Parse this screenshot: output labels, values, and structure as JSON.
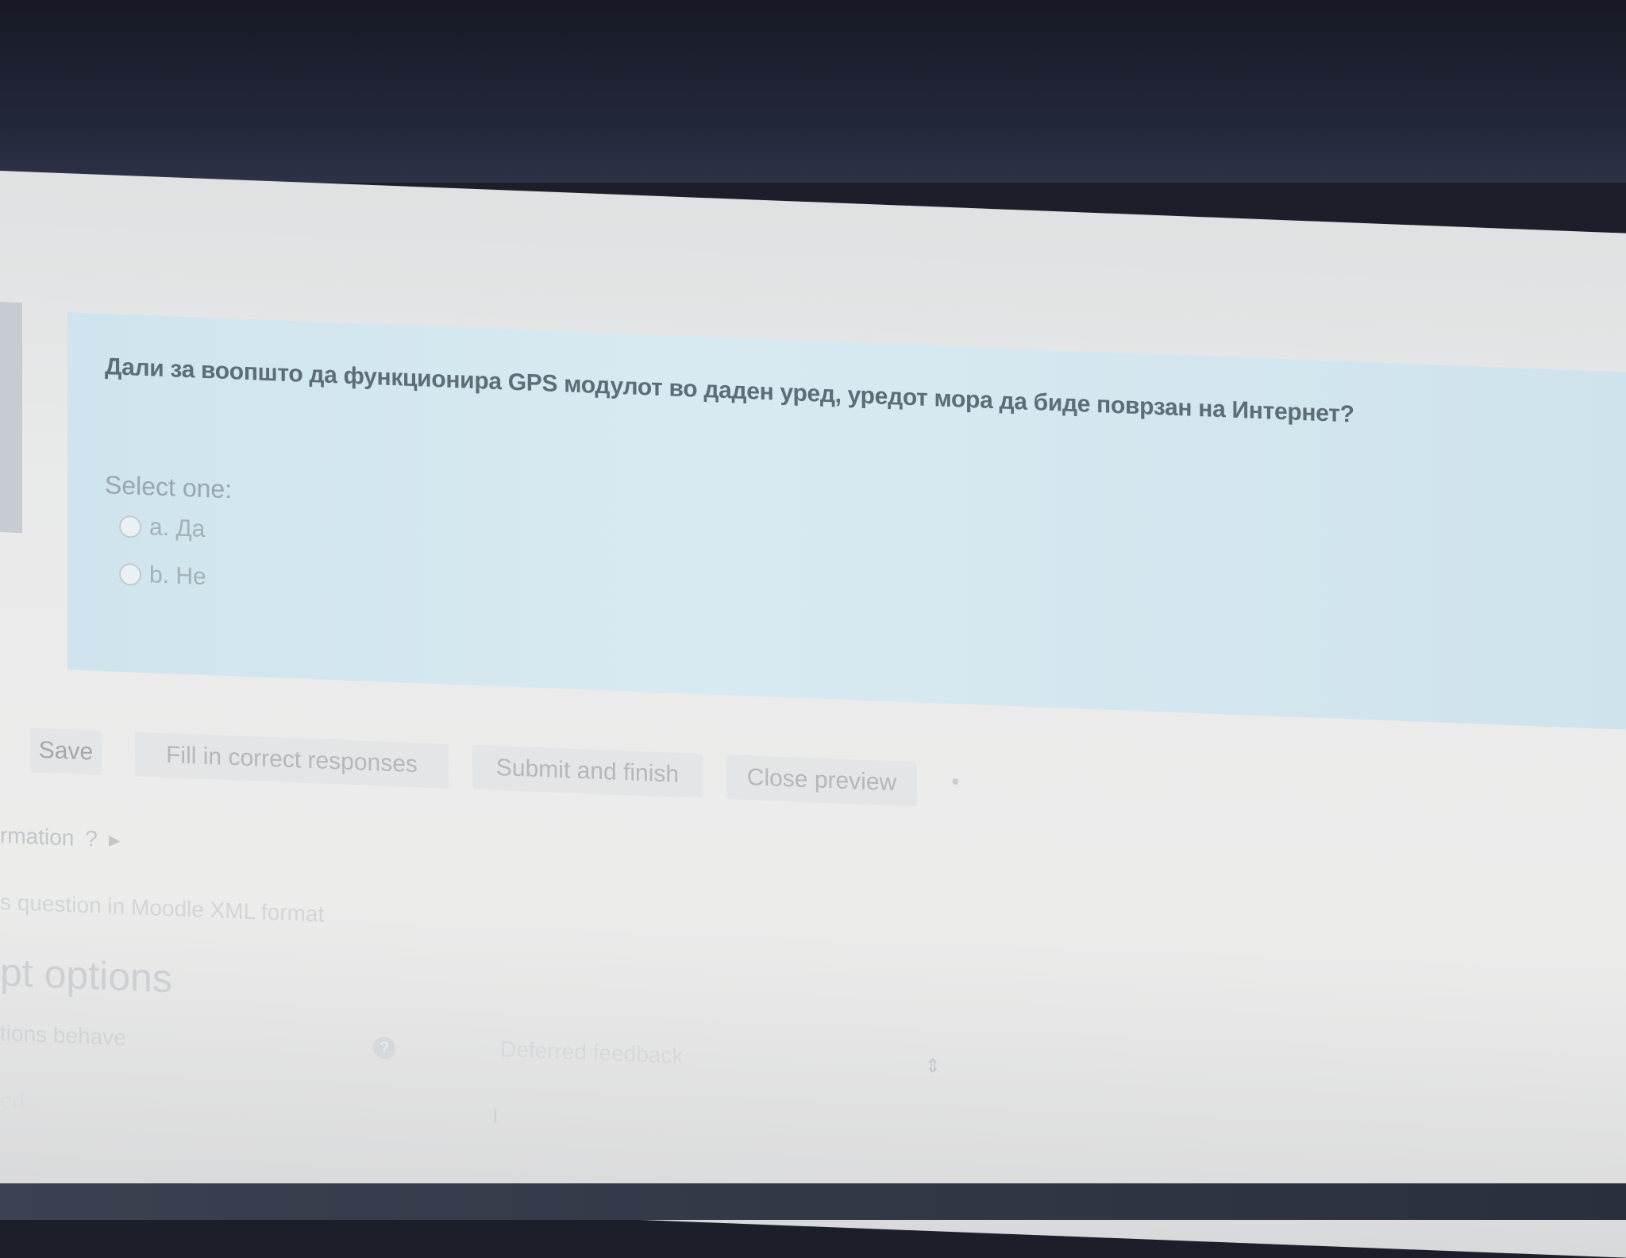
{
  "question": {
    "text": "Дали за воопшто да функционира GPS модулот во даден уред, уредот мора да биде поврзан на Интернет?",
    "prompt": "Select one:",
    "options": [
      {
        "label": "a. Да"
      },
      {
        "label": "b. Не"
      }
    ]
  },
  "actions": {
    "save": "Save",
    "fill_in": "Fill in correct responses",
    "submit": "Submit and finish",
    "close": "Close preview"
  },
  "info": {
    "label": "rmation",
    "xml_link": "s question in Moodle XML format"
  },
  "attempt_options": {
    "heading": "pt options",
    "behave_label": "tions behave",
    "behave_value": "Deferred feedback",
    "marks_label": "ed",
    "marks_value": "I"
  }
}
